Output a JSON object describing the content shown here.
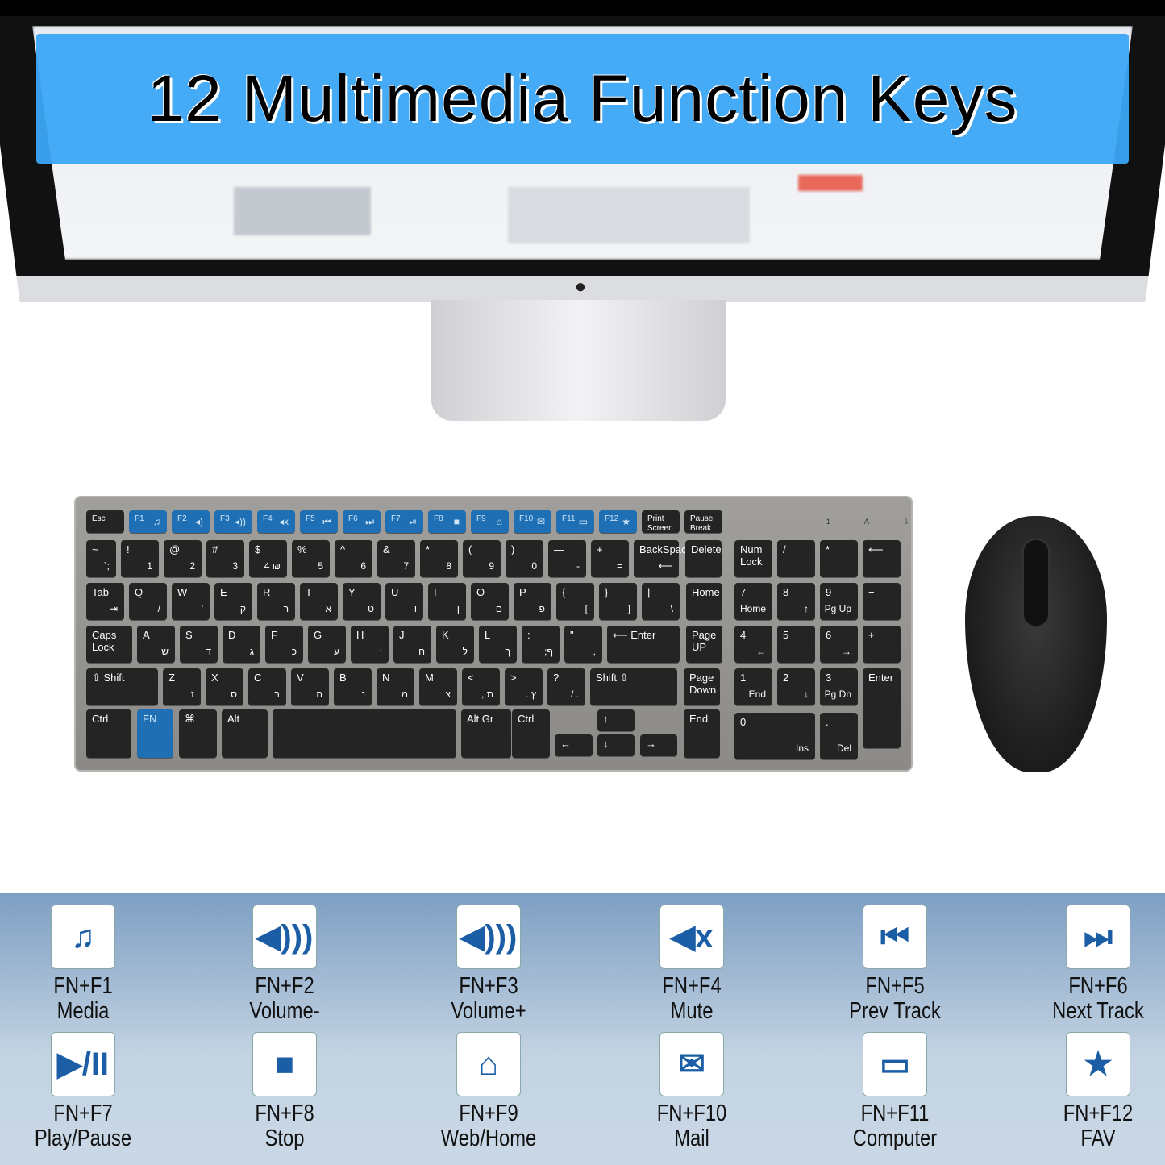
{
  "banner": {
    "title": "12 Multimedia Function Keys",
    "color": "#3ca6f5"
  },
  "monitor": {
    "logo": "apple-logo"
  },
  "keyboard": {
    "frow": [
      "Esc",
      "F1",
      "F2",
      "F3",
      "F4",
      "F5",
      "F6",
      "F7",
      "F8",
      "F9",
      "F10",
      "F11",
      "F12",
      "Print Screen",
      "Pause Break"
    ],
    "frow_icons": [
      "",
      "♫",
      "◂)",
      "◂))",
      "◂x",
      "⏮",
      "⏭",
      "⏯",
      "■",
      "⌂",
      "✉",
      "▭",
      "★"
    ],
    "row1": [
      [
        "~",
        "`;"
      ],
      [
        "!",
        "1"
      ],
      [
        "@",
        "2"
      ],
      [
        "#",
        "3"
      ],
      [
        "$",
        "4 ₪"
      ],
      [
        "%",
        "5"
      ],
      [
        "^",
        "6"
      ],
      [
        "&",
        "7"
      ],
      [
        "*",
        "8"
      ],
      [
        "(",
        "9"
      ],
      [
        ")",
        "0"
      ],
      [
        "—",
        "-"
      ],
      [
        "+",
        "="
      ],
      [
        "BackSpace",
        "⟵"
      ],
      [
        "Delete",
        ""
      ]
    ],
    "row2": [
      [
        "Tab",
        "⇥"
      ],
      [
        "Q",
        "/"
      ],
      [
        "W",
        "'"
      ],
      [
        "E",
        "ק"
      ],
      [
        "R",
        "ר"
      ],
      [
        "T",
        "א"
      ],
      [
        "Y",
        "ט"
      ],
      [
        "U",
        "ו"
      ],
      [
        "I",
        "ן"
      ],
      [
        "O",
        "ם"
      ],
      [
        "P",
        "פ"
      ],
      [
        "{",
        "["
      ],
      [
        "}",
        "]"
      ],
      [
        "|",
        "\\"
      ],
      [
        "Home",
        ""
      ]
    ],
    "row3": [
      [
        "Caps Lock",
        ""
      ],
      [
        "A",
        "ש"
      ],
      [
        "S",
        "ד"
      ],
      [
        "D",
        "ג"
      ],
      [
        "F",
        "כ"
      ],
      [
        "G",
        "ע"
      ],
      [
        "H",
        "י"
      ],
      [
        "J",
        "ח"
      ],
      [
        "K",
        "ל"
      ],
      [
        "L",
        "ך"
      ],
      [
        ":",
        ";ף"
      ],
      [
        "\"",
        ","
      ],
      [
        "⟵ Enter",
        ""
      ],
      [
        "Page UP",
        ""
      ]
    ],
    "row4": [
      [
        "⇧ Shift",
        ""
      ],
      [
        "Z",
        "ז"
      ],
      [
        "X",
        "ס"
      ],
      [
        "C",
        "ב"
      ],
      [
        "V",
        "ה"
      ],
      [
        "B",
        "נ"
      ],
      [
        "N",
        "מ"
      ],
      [
        "M",
        "צ"
      ],
      [
        "<",
        ", ת"
      ],
      [
        ">",
        ". ץ"
      ],
      [
        "?",
        "/ ."
      ],
      [
        "Shift ⇧",
        ""
      ],
      [
        "Page Down",
        ""
      ]
    ],
    "row5": [
      "Ctrl",
      "FN",
      "⌘",
      "Alt",
      "",
      "Alt Gr",
      "Ctrl",
      "←",
      "↑",
      "↓",
      "→",
      "End"
    ],
    "numpad": [
      [
        "Num Lock",
        ""
      ],
      [
        "/",
        ""
      ],
      [
        "*",
        ""
      ],
      [
        "⟵",
        ""
      ],
      [
        "7",
        "Home"
      ],
      [
        "8",
        "↑"
      ],
      [
        "9",
        "Pg Up"
      ],
      [
        "−",
        ""
      ],
      [
        "4",
        "←"
      ],
      [
        "5",
        ""
      ],
      [
        "6",
        "→"
      ],
      [
        "+",
        ""
      ],
      [
        "1",
        "End"
      ],
      [
        "2",
        "↓"
      ],
      [
        "3",
        "Pg Dn"
      ],
      [
        "Enter",
        ""
      ],
      [
        "0",
        "Ins"
      ],
      [
        ".",
        "Del"
      ]
    ],
    "leds": "1 A ⇩",
    "fn_color": "#1e6fb3"
  },
  "functions": [
    {
      "key": "FN+F1",
      "name": "Media",
      "icon": "music-note-icon",
      "glyph": "♫"
    },
    {
      "key": "FN+F2",
      "name": "Volume-",
      "icon": "volume-down-icon",
      "glyph": "◀)))"
    },
    {
      "key": "FN+F3",
      "name": "Volume+",
      "icon": "volume-up-icon",
      "glyph": "◀)))"
    },
    {
      "key": "FN+F4",
      "name": "Mute",
      "icon": "mute-icon",
      "glyph": "◀x"
    },
    {
      "key": "FN+F5",
      "name": "Prev Track",
      "icon": "previous-track-icon",
      "glyph": "⏮"
    },
    {
      "key": "FN+F6",
      "name": "Next Track",
      "icon": "next-track-icon",
      "glyph": "⏭"
    },
    {
      "key": "FN+F7",
      "name": "Play/Pause",
      "icon": "play-pause-icon",
      "glyph": "▶/II"
    },
    {
      "key": "FN+F8",
      "name": "Stop",
      "icon": "stop-icon",
      "glyph": "■"
    },
    {
      "key": "FN+F9",
      "name": "Web/Home",
      "icon": "home-icon",
      "glyph": "⌂"
    },
    {
      "key": "FN+F10",
      "name": "Mail",
      "icon": "mail-icon",
      "glyph": "✉"
    },
    {
      "key": "FN+F11",
      "name": "Computer",
      "icon": "computer-icon",
      "glyph": "▭"
    },
    {
      "key": "FN+F12",
      "name": "FAV",
      "icon": "favorites-folder-icon",
      "glyph": "★"
    }
  ],
  "icon_color": "#1c5ea6"
}
